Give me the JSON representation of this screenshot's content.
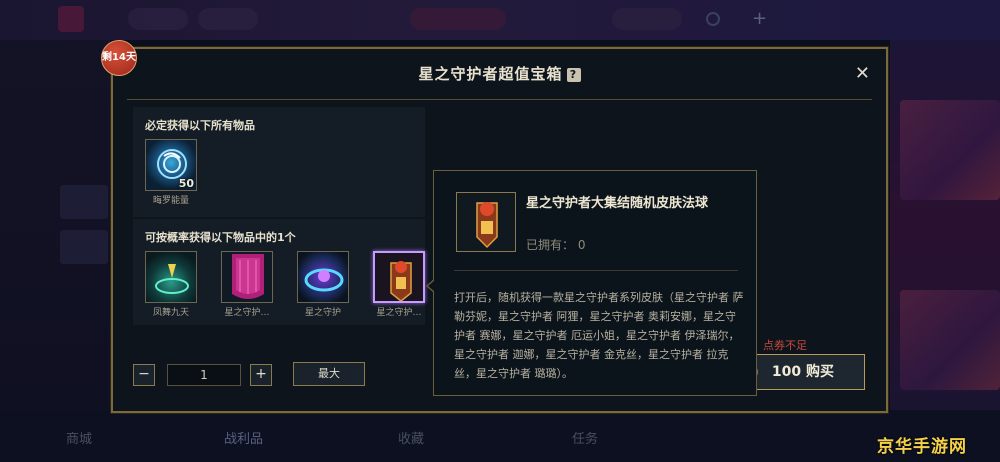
{
  "background": {
    "bottom_tabs": [
      "商城",
      "战利品",
      "收藏",
      "任务"
    ]
  },
  "dialog": {
    "title": "星之守护者超值宝箱",
    "help_label": "?",
    "close_label": "✕",
    "time_badge": "剩14天"
  },
  "guaranteed": {
    "title": "必定获得以下所有物品",
    "items": [
      {
        "label": "晦罗能量",
        "qty": "50",
        "icon": "hextech-energy-icon"
      }
    ]
  },
  "chance": {
    "title": "可按概率获得以下物品中的1个",
    "items": [
      {
        "label": "凤舞九天",
        "icon": "portal-emote-icon"
      },
      {
        "label": "星之守护…",
        "icon": "star-guardian-banner-icon"
      },
      {
        "label": "星之守护",
        "icon": "star-guardian-ring-icon"
      },
      {
        "label": "星之守护…",
        "icon": "star-guardian-orb-icon"
      }
    ]
  },
  "controls": {
    "minus": "−",
    "quantity": "1",
    "plus": "+",
    "max": "最大",
    "insufficient": "点券不足",
    "price": "100",
    "buy": "购买",
    "buy_label": "100  购买"
  },
  "tooltip": {
    "name": "星之守护者大集结随机皮肤法球",
    "owned": "已拥有： 0",
    "description": "打开后，随机获得一款星之守护者系列皮肤（星之守护者 萨勒芬妮，星之守护者 阿狸，星之守护者 奥莉安娜，星之守护者 赛娜，星之守护者 厄运小姐，星之守护者 伊泽瑞尔，星之守护者 迦娜，星之守护者 金克丝，星之守护者 拉克丝，星之守护者 璐璐）。",
    "icon": "star-guardian-orb-icon"
  },
  "watermark": "京华手游网",
  "colors": {
    "gold_border": "#7c6a3f",
    "selected_border": "#c79cff",
    "warning": "#c44a3a",
    "watermark": "#f5d14a"
  }
}
